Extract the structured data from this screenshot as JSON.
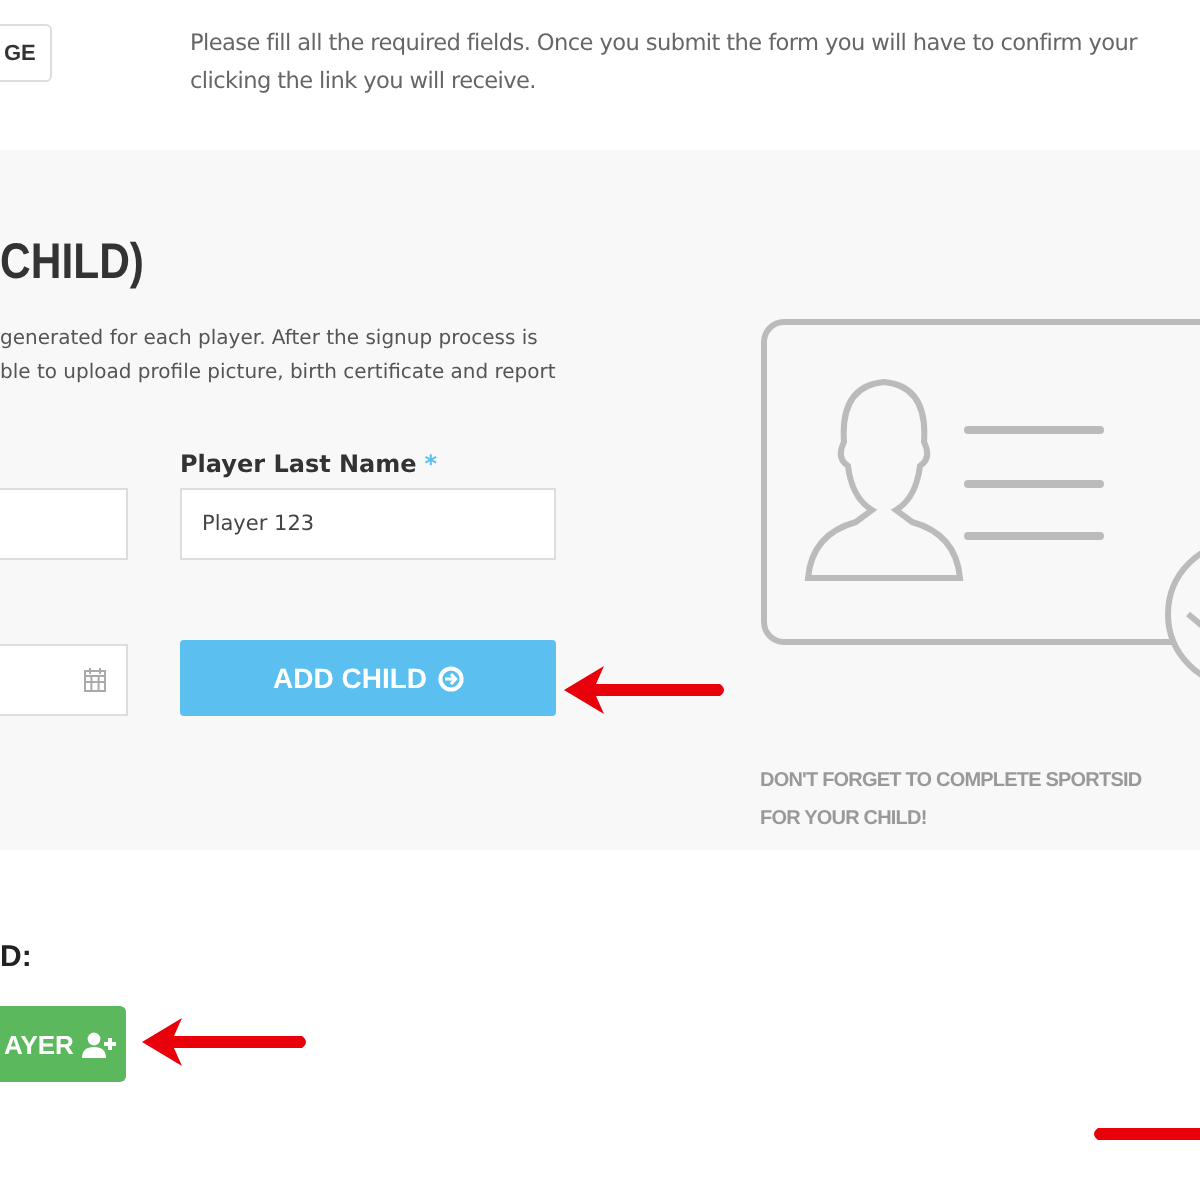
{
  "top": {
    "button_label": "GE",
    "notice_lines": [
      "Please fill all the required fields. Once you submit the form you will have to confirm your",
      "clicking the link you will receive."
    ]
  },
  "panel": {
    "heading": "CHILD)",
    "description_lines": [
      "generated for each player. After the signup process is",
      "ble to upload profile picture, birth certificate and report"
    ],
    "fields": [
      {
        "kind": "text"
      },
      {
        "kind": "text",
        "label": "Player Last Name",
        "required_mark": "*",
        "value": "Player 123"
      },
      {
        "kind": "date"
      },
      {
        "kind": "button",
        "label": "ADD CHILD"
      }
    ],
    "note_lines": [
      "DON'T FORGET TO COMPLETE SPORTSID",
      "FOR YOUR CHILD!"
    ]
  },
  "bottom": {
    "heading": "D:",
    "button_label": "AYER"
  }
}
